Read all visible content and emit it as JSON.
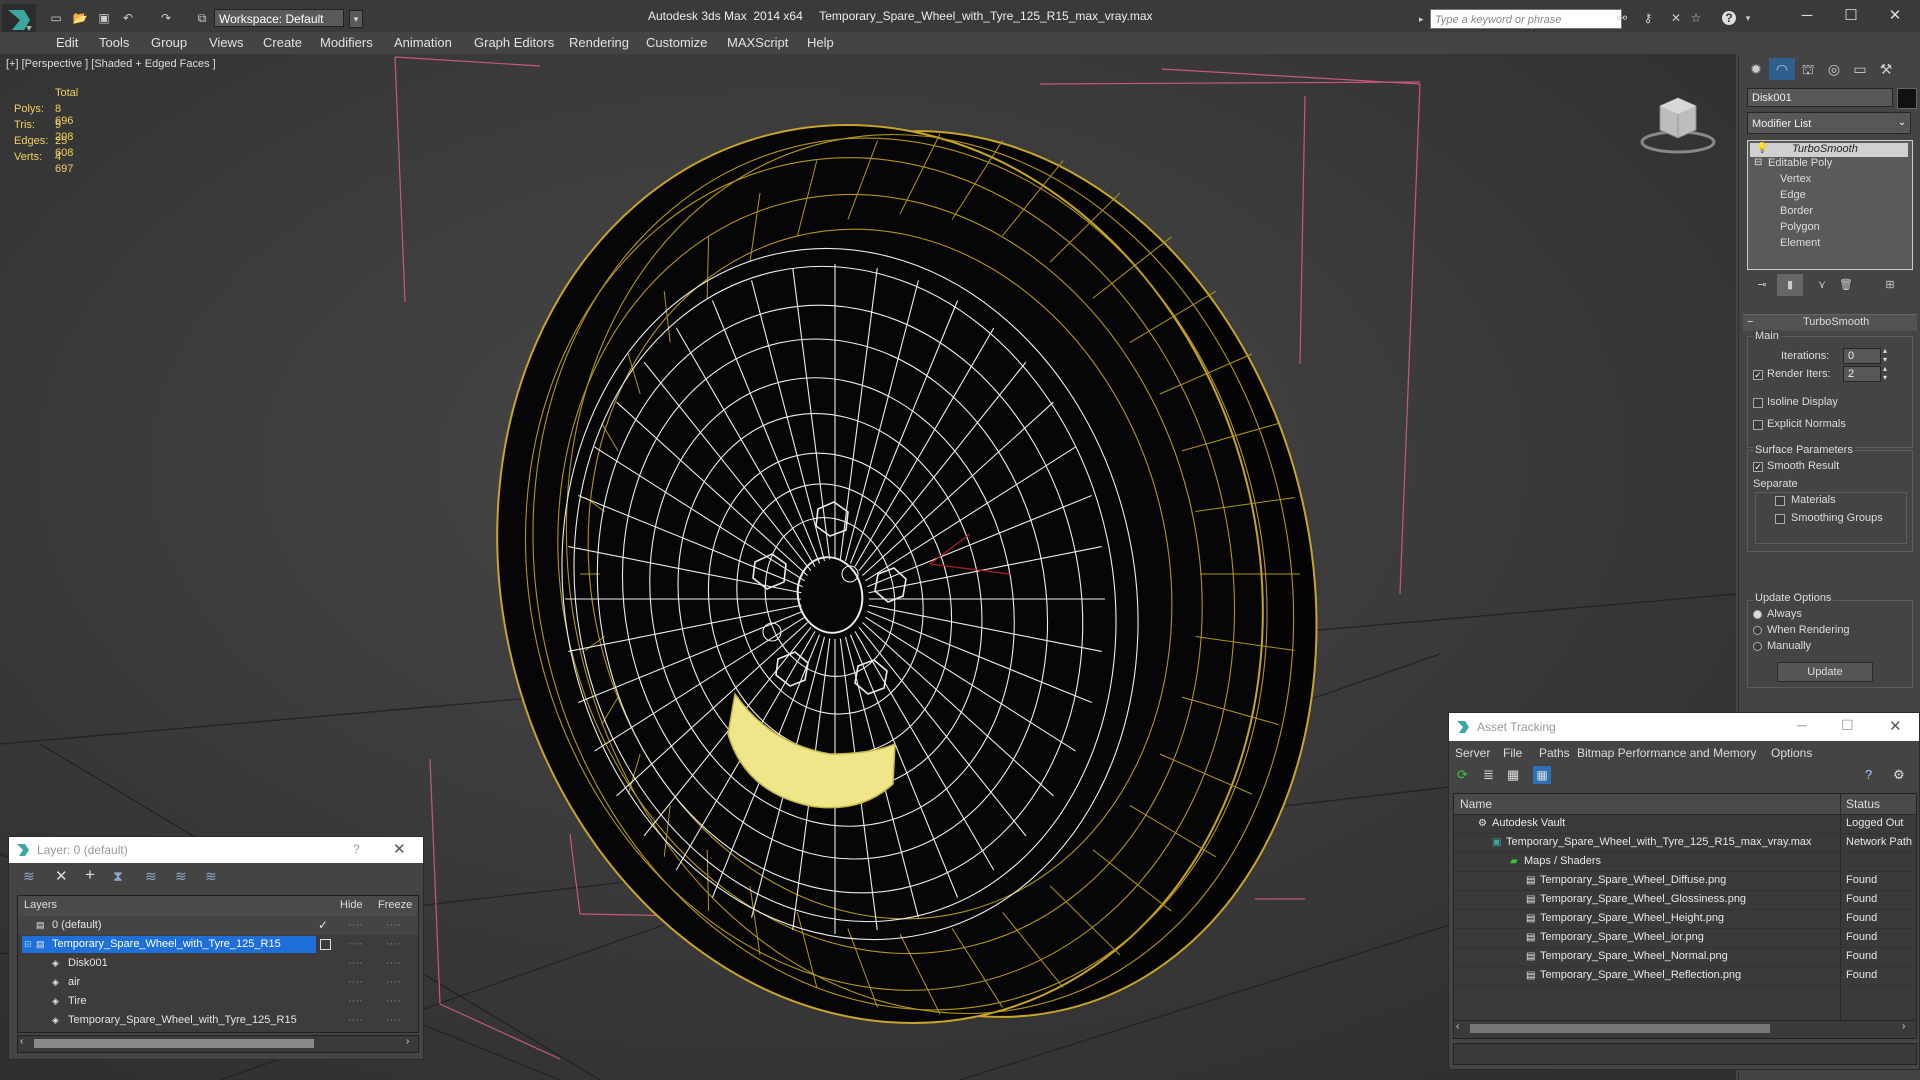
{
  "titlebar": {
    "workspace": "Workspace: Default",
    "app_name": "Autodesk 3ds Max  2014 x64",
    "file_name": "Temporary_Spare_Wheel_with_Tyre_125_R15_max_vray.max",
    "search_placeholder": "Type a keyword or phrase"
  },
  "menu": [
    "Edit",
    "Tools",
    "Group",
    "Views",
    "Create",
    "Modifiers",
    "Animation",
    "Graph Editors",
    "Rendering",
    "Customize",
    "MAXScript",
    "Help"
  ],
  "viewport": {
    "label": "[+] [Perspective ] [Shaded + Edged Faces ]",
    "stats": {
      "header": "Total",
      "rows": [
        {
          "label": "Polys:",
          "value": "8 696"
        },
        {
          "label": "Tris:",
          "value": "9 208"
        },
        {
          "label": "Edges:",
          "value": "25 608"
        },
        {
          "label": "Verts:",
          "value": "4 697"
        }
      ]
    }
  },
  "command_panel": {
    "object_name": "Disk001",
    "modifier_list": "Modifier List",
    "stack": [
      "TurboSmooth",
      "Editable Poly",
      "Vertex",
      "Edge",
      "Border",
      "Polygon",
      "Element"
    ],
    "rollout_title": "TurboSmooth",
    "main_label": "Main",
    "iterations_label": "Iterations:",
    "iterations_value": "0",
    "render_iters_label": "Render Iters:",
    "render_iters_value": "2",
    "isoline_label": "Isoline Display",
    "explicit_normals_label": "Explicit Normals",
    "surface_params_label": "Surface Parameters",
    "smooth_result_label": "Smooth Result",
    "separate_label": "Separate",
    "materials_label": "Materials",
    "smoothing_groups_label": "Smoothing Groups",
    "update_options_label": "Update Options",
    "always_label": "Always",
    "when_rendering_label": "When Rendering",
    "manually_label": "Manually",
    "update_button": "Update"
  },
  "layer_window": {
    "title": "Layer: 0 (default)",
    "help": "?",
    "col_layers": "Layers",
    "col_hide": "Hide",
    "col_freeze": "Freeze",
    "rows": [
      {
        "name": "0 (default)",
        "indent": 0,
        "selected": false
      },
      {
        "name": "Temporary_Spare_Wheel_with_Tyre_125_R15",
        "indent": 0,
        "selected": true
      },
      {
        "name": "Disk001",
        "indent": 1,
        "selected": false
      },
      {
        "name": "air",
        "indent": 1,
        "selected": false
      },
      {
        "name": "Tire",
        "indent": 1,
        "selected": false
      },
      {
        "name": "Temporary_Spare_Wheel_with_Tyre_125_R15",
        "indent": 1,
        "selected": false
      }
    ]
  },
  "asset_tracking": {
    "title": "Asset Tracking",
    "menu": [
      "Server",
      "File",
      "Paths",
      "Bitmap Performance and Memory",
      "Options"
    ],
    "col_name": "Name",
    "col_status": "Status",
    "rows": [
      {
        "name": "Autodesk Vault",
        "status": "Logged Out",
        "indent": 1
      },
      {
        "name": "Temporary_Spare_Wheel_with_Tyre_125_R15_max_vray.max",
        "status": "Network Path",
        "indent": 2
      },
      {
        "name": "Maps / Shaders",
        "status": "",
        "indent": 3
      },
      {
        "name": "Temporary_Spare_Wheel_Diffuse.png",
        "status": "Found",
        "indent": 4
      },
      {
        "name": "Temporary_Spare_Wheel_Glossiness.png",
        "status": "Found",
        "indent": 4
      },
      {
        "name": "Temporary_Spare_Wheel_Height.png",
        "status": "Found",
        "indent": 4
      },
      {
        "name": "Temporary_Spare_Wheel_ior.png",
        "status": "Found",
        "indent": 4
      },
      {
        "name": "Temporary_Spare_Wheel_Normal.png",
        "status": "Found",
        "indent": 4
      },
      {
        "name": "Temporary_Spare_Wheel_Reflection.png",
        "status": "Found",
        "indent": 4
      }
    ]
  },
  "colors": {
    "wire_edge": "#c8a428",
    "wire_white": "#f0f0f0",
    "selection_blue": "#1f6fd8",
    "stats_yellow": "#f2d060"
  }
}
